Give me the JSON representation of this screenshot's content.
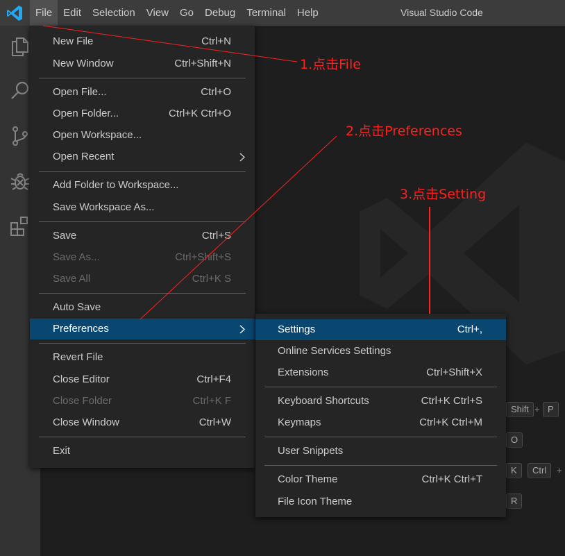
{
  "titlebar": {
    "menus": [
      "File",
      "Edit",
      "Selection",
      "View",
      "Go",
      "Debug",
      "Terminal",
      "Help"
    ],
    "active_menu": "File",
    "window_title": "Visual Studio Code",
    "logo_icon": "vscode-logo-icon"
  },
  "activitybar": {
    "icons": [
      "explorer-icon",
      "search-icon",
      "source-control-icon",
      "debug-icon",
      "extensions-icon"
    ]
  },
  "file_menu": {
    "items": [
      {
        "label": "New File",
        "shortcut": "Ctrl+N"
      },
      {
        "label": "New Window",
        "shortcut": "Ctrl+Shift+N"
      },
      {
        "label": "Open File...",
        "shortcut": "Ctrl+O"
      },
      {
        "label": "Open Folder...",
        "shortcut": "Ctrl+K Ctrl+O"
      },
      {
        "label": "Open Workspace...",
        "shortcut": ""
      },
      {
        "label": "Open Recent",
        "shortcut": ""
      },
      {
        "label": "Add Folder to Workspace...",
        "shortcut": ""
      },
      {
        "label": "Save Workspace As...",
        "shortcut": ""
      },
      {
        "label": "Save",
        "shortcut": "Ctrl+S"
      },
      {
        "label": "Save As...",
        "shortcut": "Ctrl+Shift+S"
      },
      {
        "label": "Save All",
        "shortcut": "Ctrl+K S"
      },
      {
        "label": "Auto Save",
        "shortcut": ""
      },
      {
        "label": "Preferences",
        "shortcut": ""
      },
      {
        "label": "Revert File",
        "shortcut": ""
      },
      {
        "label": "Close Editor",
        "shortcut": "Ctrl+F4"
      },
      {
        "label": "Close Folder",
        "shortcut": "Ctrl+K F"
      },
      {
        "label": "Close Window",
        "shortcut": "Ctrl+W"
      },
      {
        "label": "Exit",
        "shortcut": ""
      }
    ]
  },
  "preferences_submenu": {
    "items": [
      {
        "label": "Settings",
        "shortcut": "Ctrl+,"
      },
      {
        "label": "Online Services Settings",
        "shortcut": ""
      },
      {
        "label": "Extensions",
        "shortcut": "Ctrl+Shift+X"
      },
      {
        "label": "Keyboard Shortcuts",
        "shortcut": "Ctrl+K Ctrl+S"
      },
      {
        "label": "Keymaps",
        "shortcut": "Ctrl+K Ctrl+M"
      },
      {
        "label": "User Snippets",
        "shortcut": ""
      },
      {
        "label": "Color Theme",
        "shortcut": "Ctrl+K Ctrl+T"
      },
      {
        "label": "File Icon Theme",
        "shortcut": ""
      }
    ]
  },
  "editor_hints": {
    "keys": [
      "Shift",
      "+",
      "P",
      "O",
      "K",
      "Ctrl",
      "+",
      "R"
    ]
  },
  "annotations": {
    "step1": "1.点击File",
    "step2": "2.点击Preferences",
    "step3": "3.点击Setting",
    "color": "#ff2020"
  },
  "colors": {
    "titlebar_bg": "#3c3c3c",
    "activitybar_bg": "#333333",
    "editor_bg": "#1e1e1e",
    "menu_bg": "#252526",
    "selection_bg": "#094771",
    "vscode_blue": "#23a9f2"
  }
}
